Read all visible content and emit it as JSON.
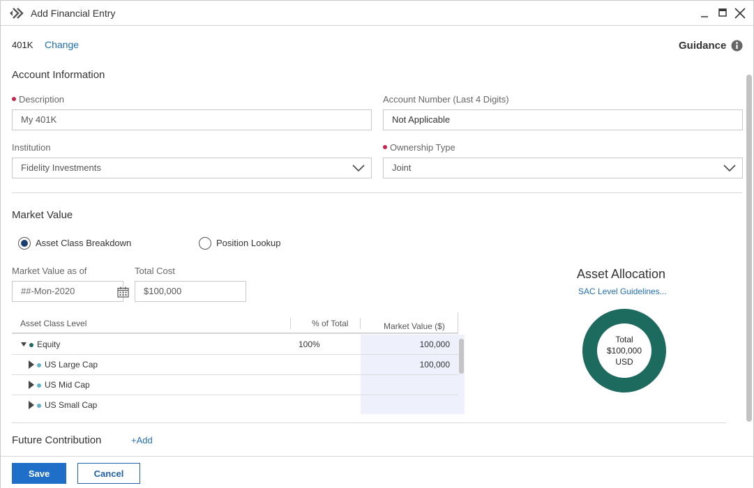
{
  "window": {
    "title": "Add Financial Entry"
  },
  "header": {
    "account_type": "401K",
    "change_label": "Change",
    "guidance_label": "Guidance"
  },
  "account_info": {
    "section_title": "Account Information",
    "description_label": "Description",
    "description_value": "My 401K",
    "account_number_label": "Account Number (Last 4 Digits)",
    "account_number_value": "Not Applicable",
    "institution_label": "Institution",
    "institution_value": "Fidelity Investments",
    "ownership_label": "Ownership Type",
    "ownership_value": "Joint"
  },
  "market_value": {
    "section_title": "Market Value",
    "options": [
      {
        "label": "Asset Class Breakdown",
        "checked": true
      },
      {
        "label": "Position Lookup",
        "checked": false
      }
    ],
    "as_of_label": "Market Value as of",
    "as_of_placeholder": "##-Mon-2020",
    "total_cost_label": "Total Cost",
    "total_cost_value": "$100,000"
  },
  "asset_table": {
    "columns": [
      "Asset Class Level",
      "% of Total",
      "Market Value ($)"
    ],
    "rows": [
      {
        "name": "Equity",
        "percent": "100%",
        "value": "100,000",
        "expanded": true,
        "dot_color": "#1d6b5f"
      },
      {
        "name": "US Large Cap",
        "percent": "",
        "value": "100,000",
        "expanded": false,
        "dot_color": "#5fb3c8"
      },
      {
        "name": "US Mid Cap",
        "percent": "",
        "value": "",
        "expanded": false,
        "dot_color": "#5fb3c8"
      },
      {
        "name": "US Small Cap",
        "percent": "",
        "value": "",
        "expanded": false,
        "dot_color": "#5fb3c8"
      }
    ]
  },
  "allocation": {
    "title": "Asset Allocation",
    "link_label": "SAC Level Guidelines...",
    "center_line1": "Total",
    "center_line2": "$100,000",
    "center_line3": "USD",
    "ring_color": "#1d6b5f"
  },
  "future": {
    "section_title": "Future Contribution",
    "add_label": "+Add"
  },
  "footer": {
    "save_label": "Save",
    "cancel_label": "Cancel"
  }
}
